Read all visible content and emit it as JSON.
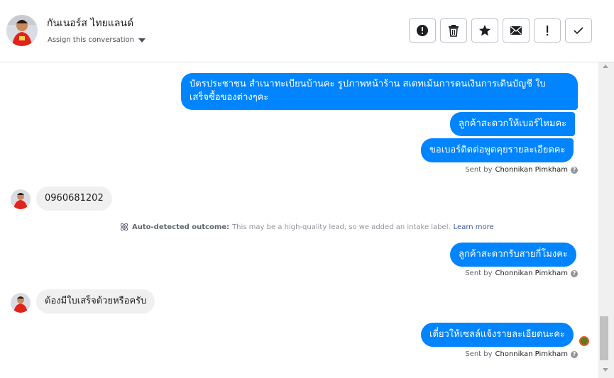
{
  "header": {
    "contact_name": "กันเนอร์ส ไทยแลนด์",
    "assign_label": "Assign this conversation",
    "actions": [
      {
        "name": "mark-spam-button",
        "icon": "alert-circle-icon"
      },
      {
        "name": "delete-button",
        "icon": "trash-icon"
      },
      {
        "name": "star-button",
        "icon": "star-icon"
      },
      {
        "name": "mark-unread-button",
        "icon": "envelope-icon"
      },
      {
        "name": "follow-up-button",
        "icon": "exclamation-icon"
      },
      {
        "name": "mark-done-button",
        "icon": "checkmark-icon"
      }
    ]
  },
  "messages": {
    "out_1_line1": "บัตรประชาชน สำเนาทะเบียนบ้านคะ รูปภาพหน้าร้าน สเตทเม้นการดนเงินการเดินบัญชี ใบ",
    "out_1_line2": "เสร็จซื้อของต่างๆคะ",
    "out_2": "ลูกค้าสะดวกให้เบอร์ไหมคะ",
    "out_3": "ขอเบอร์ติดต่อพูดคุยรายละเอียดคะ",
    "sent_prefix": "Sent by",
    "sender": "Chonnikan Pimkham",
    "in_1": "0960681202",
    "outcome_title": "Auto-detected outcome:",
    "outcome_text": "This may be a high-quality lead, so we added an intake label.",
    "outcome_link": "Learn more",
    "out_4": "ลูกค้าสะดวกรับสายกี่โมงคะ",
    "in_2": "ต้องมีใบเสร็จด้วยหรือครับ",
    "out_5": "เดี๋ยวให้เซลล์แจ้งรายละเอียดนะคะ"
  },
  "colors": {
    "outgoing_bubble": "#0084ff",
    "incoming_bubble": "#f1f0f0",
    "link": "#385898"
  }
}
